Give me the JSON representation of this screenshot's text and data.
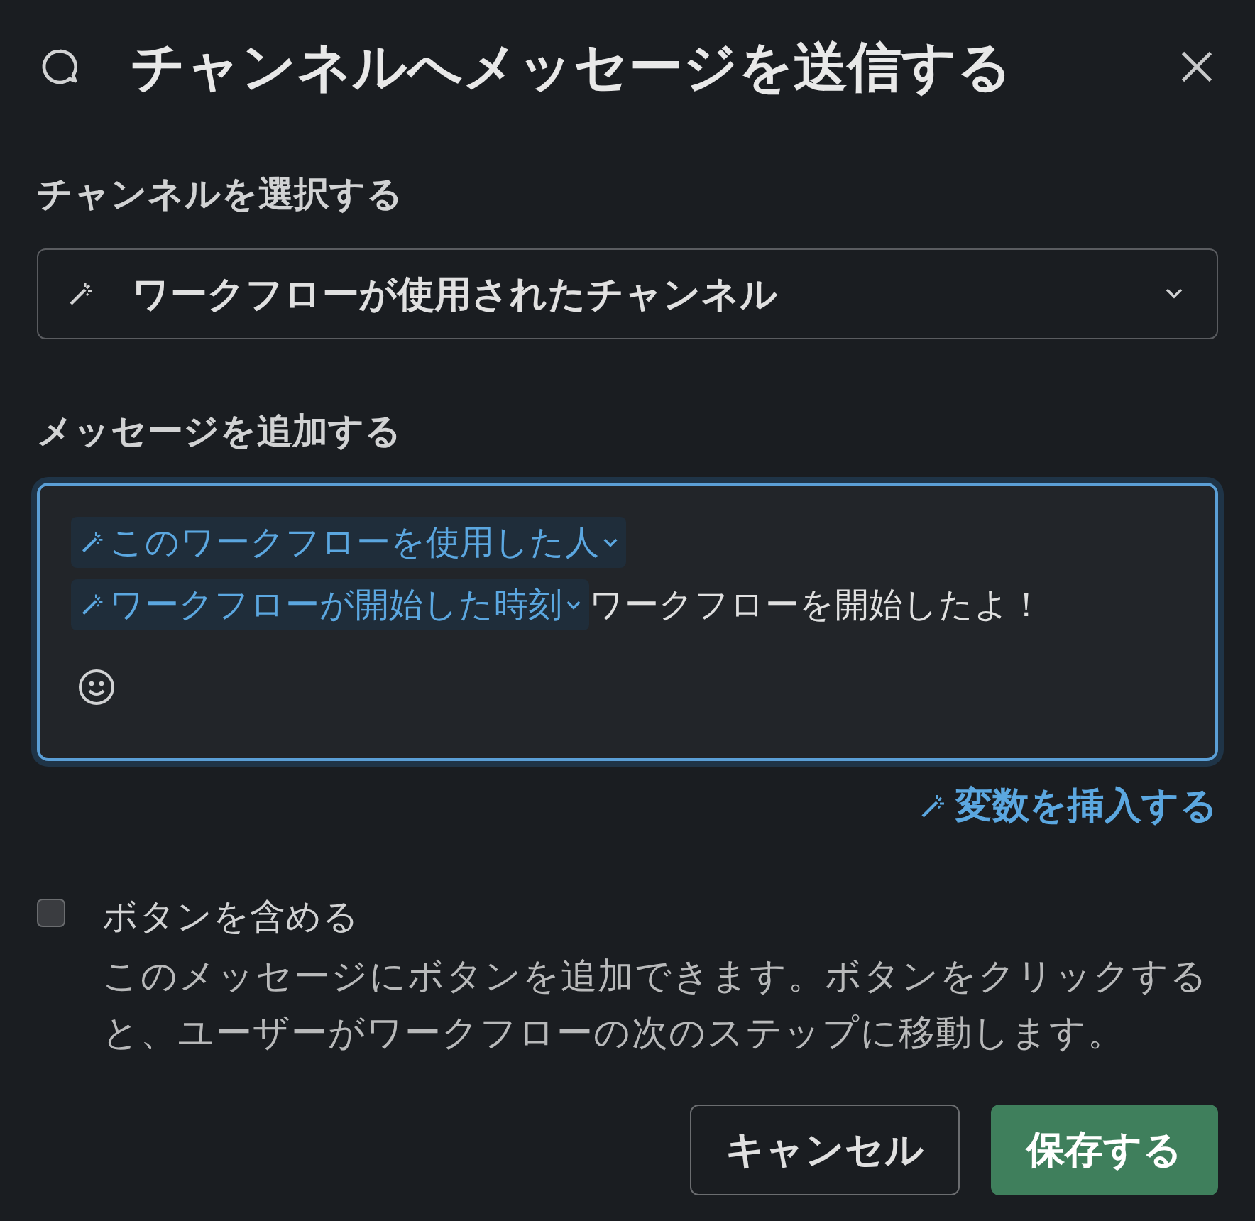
{
  "dialog": {
    "title": "チャンネルへメッセージを送信する"
  },
  "channel": {
    "label": "チャンネルを選択する",
    "value": "ワークフローが使用されたチャンネル"
  },
  "message": {
    "label": "メッセージを追加する",
    "focused": true,
    "lines": [
      [
        {
          "kind": "variable",
          "text": "このワークフローを使用した人"
        }
      ],
      [
        {
          "kind": "variable",
          "text": "ワークフローが開始した時刻"
        },
        {
          "kind": "text",
          "text": "ワークフローを開始したよ！"
        }
      ]
    ]
  },
  "insert_variable": "変数を挿入する",
  "include_buttons": {
    "label": "ボタンを含める",
    "checked": false,
    "description": "このメッセージにボタンを追加できます。ボタンをクリックすると、ユーザーがワークフローの次のステップに移動します。"
  },
  "buttons": [
    {
      "label": "キャンセル",
      "kind": "secondary"
    },
    {
      "label": "保存する",
      "kind": "primary"
    }
  ]
}
